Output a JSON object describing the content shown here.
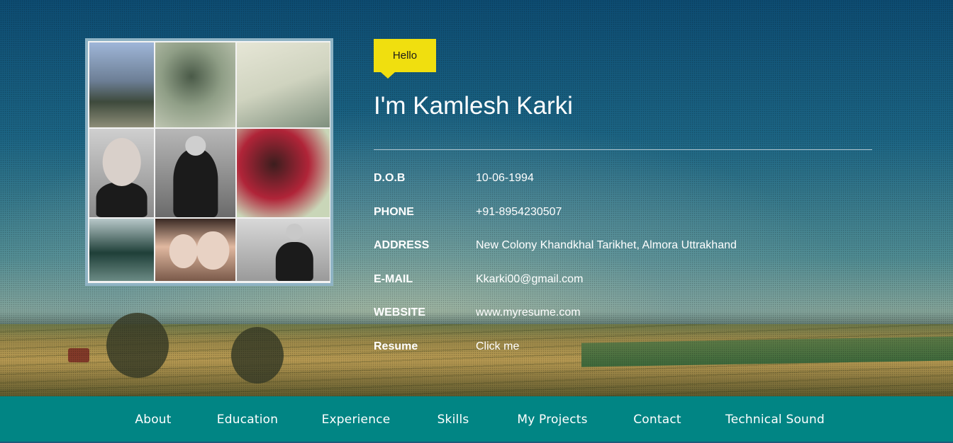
{
  "hero": {
    "greeting": "Hello",
    "name_heading": "I'm Kamlesh Karki"
  },
  "details": [
    {
      "label": "D.O.B",
      "value": "10-06-1994"
    },
    {
      "label": "PHONE",
      "value": "+91-8954230507"
    },
    {
      "label": "ADDRESS",
      "value": "New Colony Khandkhal Tarikhet, Almora Uttrakhand"
    },
    {
      "label": "E-MAIL",
      "value": "Kkarki00@gmail.com"
    },
    {
      "label": "WEBSITE",
      "value": "www.myresume.com"
    },
    {
      "label": "Resume",
      "value": "Click me"
    }
  ],
  "nav": {
    "items": [
      {
        "label": "About"
      },
      {
        "label": "Education"
      },
      {
        "label": "Experience"
      },
      {
        "label": "Skills"
      },
      {
        "label": "My Projects"
      },
      {
        "label": "Contact"
      },
      {
        "label": "Technical Sound"
      }
    ]
  },
  "colors": {
    "accent_yellow": "#f0df0f",
    "nav_teal": "#018584",
    "text": "#ffffff"
  }
}
